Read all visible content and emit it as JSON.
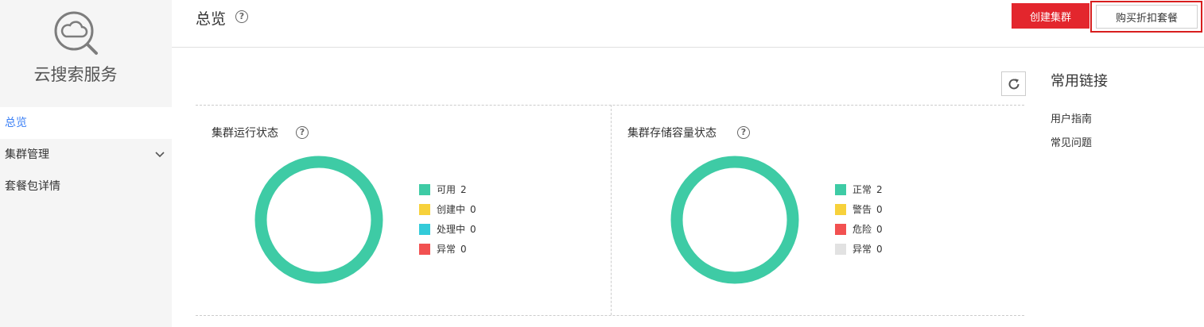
{
  "sidebar": {
    "title": "云搜索服务",
    "logo_icon": "search-cloud-icon",
    "items": [
      {
        "label": "总览",
        "active": true
      },
      {
        "label": "集群管理",
        "has_submenu": true
      },
      {
        "label": "套餐包详情"
      }
    ]
  },
  "header": {
    "title": "总览",
    "help_icon": "?",
    "create_button": "创建集群",
    "buy_button": "购买折扣套餐"
  },
  "cards": [
    {
      "title": "集群运行状态",
      "help_icon": "?",
      "legend": [
        {
          "label": "可用",
          "count": "2",
          "color": "#3ecba5"
        },
        {
          "label": "创建中",
          "count": "0",
          "color": "#f7d13b"
        },
        {
          "label": "处理中",
          "count": "0",
          "color": "#33cbd9"
        },
        {
          "label": "异常",
          "count": "0",
          "color": "#f25151"
        }
      ]
    },
    {
      "title": "集群存储容量状态",
      "help_icon": "?",
      "legend": [
        {
          "label": "正常",
          "count": "2",
          "color": "#3ecba5"
        },
        {
          "label": "警告",
          "count": "0",
          "color": "#f7d13b"
        },
        {
          "label": "危险",
          "count": "0",
          "color": "#f25151"
        },
        {
          "label": "异常",
          "count": "0",
          "color": "#e2e2e2"
        }
      ]
    }
  ],
  "links": {
    "title": "常用链接",
    "items": [
      "用户指南",
      "常见问题"
    ]
  },
  "colors": {
    "accent": "#3a7ff6",
    "primary_button": "#e3262d",
    "donut": "#3ecba5"
  }
}
